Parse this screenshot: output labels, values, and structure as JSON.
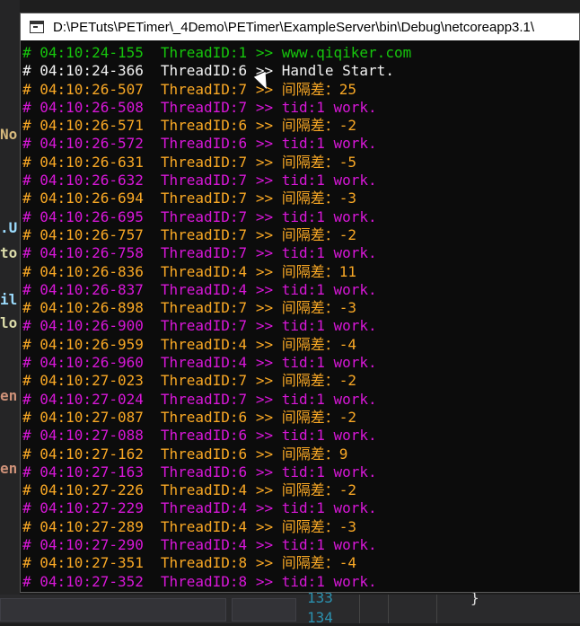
{
  "window": {
    "title": "D:\\PETuts\\PETimer\\_4Demo\\PETimer\\ExampleServer\\bin\\Debug\\netcoreapp3.1\\"
  },
  "colors": {
    "green": "#16c60c",
    "white": "#f2f2f2",
    "yellow": "#f9a825",
    "magenta": "#d817d8",
    "console_bg": "#0c0c0c"
  },
  "lines": [
    {
      "color": "green",
      "ts": "# 04:10:24-155",
      "thread": "ThreadID:1",
      "msg": " >> www.qiqiker.com"
    },
    {
      "color": "white",
      "ts": "# 04:10:24-366",
      "thread": "ThreadID:6",
      "msg": " >> Handle Start."
    },
    {
      "color": "yellow",
      "ts": "# 04:10:26-507",
      "thread": "ThreadID:7",
      "msg": " >> 间隔差：25"
    },
    {
      "color": "magenta",
      "ts": "# 04:10:26-508",
      "thread": "ThreadID:7",
      "msg": " >> tid:1 work."
    },
    {
      "color": "yellow",
      "ts": "# 04:10:26-571",
      "thread": "ThreadID:6",
      "msg": " >> 间隔差：-2"
    },
    {
      "color": "magenta",
      "ts": "# 04:10:26-572",
      "thread": "ThreadID:6",
      "msg": " >> tid:1 work."
    },
    {
      "color": "yellow",
      "ts": "# 04:10:26-631",
      "thread": "ThreadID:7",
      "msg": " >> 间隔差：-5"
    },
    {
      "color": "magenta",
      "ts": "# 04:10:26-632",
      "thread": "ThreadID:7",
      "msg": " >> tid:1 work."
    },
    {
      "color": "yellow",
      "ts": "# 04:10:26-694",
      "thread": "ThreadID:7",
      "msg": " >> 间隔差：-3"
    },
    {
      "color": "magenta",
      "ts": "# 04:10:26-695",
      "thread": "ThreadID:7",
      "msg": " >> tid:1 work."
    },
    {
      "color": "yellow",
      "ts": "# 04:10:26-757",
      "thread": "ThreadID:7",
      "msg": " >> 间隔差：-2"
    },
    {
      "color": "magenta",
      "ts": "# 04:10:26-758",
      "thread": "ThreadID:7",
      "msg": " >> tid:1 work."
    },
    {
      "color": "yellow",
      "ts": "# 04:10:26-836",
      "thread": "ThreadID:4",
      "msg": " >> 间隔差：11"
    },
    {
      "color": "magenta",
      "ts": "# 04:10:26-837",
      "thread": "ThreadID:4",
      "msg": " >> tid:1 work."
    },
    {
      "color": "yellow",
      "ts": "# 04:10:26-898",
      "thread": "ThreadID:7",
      "msg": " >> 间隔差：-3"
    },
    {
      "color": "magenta",
      "ts": "# 04:10:26-900",
      "thread": "ThreadID:7",
      "msg": " >> tid:1 work."
    },
    {
      "color": "yellow",
      "ts": "# 04:10:26-959",
      "thread": "ThreadID:4",
      "msg": " >> 间隔差：-4"
    },
    {
      "color": "magenta",
      "ts": "# 04:10:26-960",
      "thread": "ThreadID:4",
      "msg": " >> tid:1 work."
    },
    {
      "color": "yellow",
      "ts": "# 04:10:27-023",
      "thread": "ThreadID:7",
      "msg": " >> 间隔差：-2"
    },
    {
      "color": "magenta",
      "ts": "# 04:10:27-024",
      "thread": "ThreadID:7",
      "msg": " >> tid:1 work."
    },
    {
      "color": "yellow",
      "ts": "# 04:10:27-087",
      "thread": "ThreadID:6",
      "msg": " >> 间隔差：-2"
    },
    {
      "color": "magenta",
      "ts": "# 04:10:27-088",
      "thread": "ThreadID:6",
      "msg": " >> tid:1 work."
    },
    {
      "color": "yellow",
      "ts": "# 04:10:27-162",
      "thread": "ThreadID:6",
      "msg": " >> 间隔差：9"
    },
    {
      "color": "magenta",
      "ts": "# 04:10:27-163",
      "thread": "ThreadID:6",
      "msg": " >> tid:1 work."
    },
    {
      "color": "yellow",
      "ts": "# 04:10:27-226",
      "thread": "ThreadID:4",
      "msg": " >> 间隔差：-2"
    },
    {
      "color": "magenta",
      "ts": "# 04:10:27-229",
      "thread": "ThreadID:4",
      "msg": " >> tid:1 work."
    },
    {
      "color": "yellow",
      "ts": "# 04:10:27-289",
      "thread": "ThreadID:4",
      "msg": " >> 间隔差：-3"
    },
    {
      "color": "magenta",
      "ts": "# 04:10:27-290",
      "thread": "ThreadID:4",
      "msg": " >> tid:1 work."
    },
    {
      "color": "yellow",
      "ts": "# 04:10:27-351",
      "thread": "ThreadID:8",
      "msg": " >> 间隔差：-4"
    },
    {
      "color": "magenta",
      "ts": "# 04:10:27-352",
      "thread": "ThreadID:8",
      "msg": " >> tid:1 work."
    }
  ],
  "ide": {
    "fragments": [
      "No",
      ".U",
      "to",
      "il",
      "lo",
      "en",
      "en"
    ],
    "line_numbers": [
      "133",
      "134"
    ],
    "brace": "}"
  }
}
